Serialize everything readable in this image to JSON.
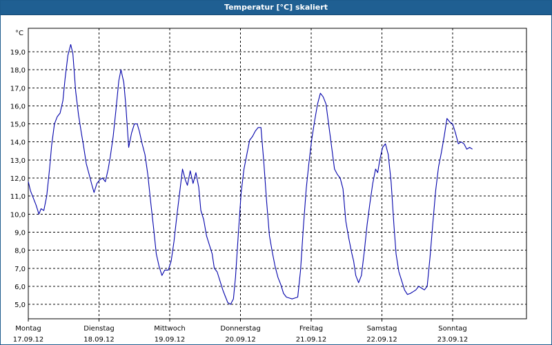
{
  "window": {
    "title": "Temperatur [°C] skaliert"
  },
  "chart_data": {
    "type": "line",
    "unit_label": "°C",
    "ylim": [
      4.2,
      20.3
    ],
    "yticks": [
      "5,0",
      "6,0",
      "7,0",
      "8,0",
      "9,0",
      "10,0",
      "11,0",
      "12,0",
      "13,0",
      "14,0",
      "15,0",
      "16,0",
      "17,0",
      "18,0",
      "19,0"
    ],
    "grid": true,
    "x_days": [
      {
        "weekday": "Montag",
        "date": "17.09.12"
      },
      {
        "weekday": "Dienstag",
        "date": "18.09.12"
      },
      {
        "weekday": "Mittwoch",
        "date": "19.09.12"
      },
      {
        "weekday": "Donnerstag",
        "date": "20.09.12"
      },
      {
        "weekday": "Freitag",
        "date": "21.09.12"
      },
      {
        "weekday": "Samstag",
        "date": "22.09.12"
      },
      {
        "weekday": "Sonntag",
        "date": "23.09.12"
      }
    ],
    "series": [
      {
        "color": "#0000aa",
        "points": [
          [
            0.0,
            11.8
          ],
          [
            0.03,
            11.3
          ],
          [
            0.07,
            10.9
          ],
          [
            0.11,
            10.5
          ],
          [
            0.15,
            10.0
          ],
          [
            0.18,
            10.3
          ],
          [
            0.22,
            10.2
          ],
          [
            0.26,
            11.0
          ],
          [
            0.3,
            12.5
          ],
          [
            0.33,
            13.8
          ],
          [
            0.37,
            15.0
          ],
          [
            0.41,
            15.4
          ],
          [
            0.45,
            15.6
          ],
          [
            0.49,
            16.3
          ],
          [
            0.52,
            17.5
          ],
          [
            0.56,
            18.8
          ],
          [
            0.6,
            19.4
          ],
          [
            0.63,
            18.9
          ],
          [
            0.67,
            16.8
          ],
          [
            0.71,
            15.5
          ],
          [
            0.75,
            14.5
          ],
          [
            0.78,
            13.8
          ],
          [
            0.82,
            12.8
          ],
          [
            0.86,
            12.2
          ],
          [
            0.9,
            11.6
          ],
          [
            0.93,
            11.2
          ],
          [
            0.97,
            11.7
          ],
          [
            1.01,
            11.9
          ],
          [
            1.05,
            12.0
          ],
          [
            1.09,
            11.8
          ],
          [
            1.13,
            12.5
          ],
          [
            1.16,
            13.2
          ],
          [
            1.2,
            14.3
          ],
          [
            1.24,
            15.8
          ],
          [
            1.28,
            17.4
          ],
          [
            1.31,
            18.0
          ],
          [
            1.35,
            17.3
          ],
          [
            1.38,
            16.0
          ],
          [
            1.42,
            13.7
          ],
          [
            1.46,
            14.5
          ],
          [
            1.5,
            15.0
          ],
          [
            1.54,
            15.0
          ],
          [
            1.57,
            14.6
          ],
          [
            1.61,
            13.9
          ],
          [
            1.65,
            13.3
          ],
          [
            1.69,
            12.2
          ],
          [
            1.73,
            10.7
          ],
          [
            1.77,
            9.3
          ],
          [
            1.81,
            7.8
          ],
          [
            1.85,
            7.1
          ],
          [
            1.89,
            6.6
          ],
          [
            1.93,
            6.9
          ],
          [
            1.98,
            6.9
          ],
          [
            2.02,
            7.4
          ],
          [
            2.06,
            8.5
          ],
          [
            2.1,
            9.9
          ],
          [
            2.14,
            11.2
          ],
          [
            2.18,
            12.5
          ],
          [
            2.22,
            11.9
          ],
          [
            2.25,
            11.6
          ],
          [
            2.29,
            12.4
          ],
          [
            2.33,
            11.7
          ],
          [
            2.37,
            12.3
          ],
          [
            2.41,
            11.5
          ],
          [
            2.44,
            10.2
          ],
          [
            2.48,
            9.7
          ],
          [
            2.52,
            8.8
          ],
          [
            2.56,
            8.3
          ],
          [
            2.6,
            7.8
          ],
          [
            2.63,
            7.0
          ],
          [
            2.67,
            6.8
          ],
          [
            2.71,
            6.3
          ],
          [
            2.75,
            5.8
          ],
          [
            2.78,
            5.5
          ],
          [
            2.82,
            5.1
          ],
          [
            2.86,
            5.0
          ],
          [
            2.9,
            5.3
          ],
          [
            2.93,
            6.5
          ],
          [
            2.97,
            8.9
          ],
          [
            3.01,
            11.2
          ],
          [
            3.05,
            12.5
          ],
          [
            3.09,
            13.3
          ],
          [
            3.13,
            14.1
          ],
          [
            3.17,
            14.3
          ],
          [
            3.21,
            14.6
          ],
          [
            3.25,
            14.8
          ],
          [
            3.29,
            14.8
          ],
          [
            3.33,
            12.9
          ],
          [
            3.37,
            10.7
          ],
          [
            3.41,
            8.8
          ],
          [
            3.45,
            7.9
          ],
          [
            3.49,
            7.1
          ],
          [
            3.53,
            6.5
          ],
          [
            3.57,
            6.1
          ],
          [
            3.61,
            5.6
          ],
          [
            3.65,
            5.4
          ],
          [
            3.69,
            5.35
          ],
          [
            3.73,
            5.3
          ],
          [
            3.77,
            5.35
          ],
          [
            3.81,
            5.4
          ],
          [
            3.85,
            6.9
          ],
          [
            3.89,
            9.3
          ],
          [
            3.93,
            11.4
          ],
          [
            3.97,
            12.9
          ],
          [
            4.01,
            14.2
          ],
          [
            4.05,
            15.2
          ],
          [
            4.09,
            16.1
          ],
          [
            4.13,
            16.7
          ],
          [
            4.17,
            16.5
          ],
          [
            4.21,
            16.1
          ],
          [
            4.25,
            14.9
          ],
          [
            4.29,
            13.7
          ],
          [
            4.33,
            12.5
          ],
          [
            4.37,
            12.2
          ],
          [
            4.41,
            12.0
          ],
          [
            4.45,
            11.4
          ],
          [
            4.49,
            9.6
          ],
          [
            4.53,
            8.7
          ],
          [
            4.57,
            7.9
          ],
          [
            4.6,
            7.4
          ],
          [
            4.63,
            6.6
          ],
          [
            4.67,
            6.2
          ],
          [
            4.71,
            6.6
          ],
          [
            4.75,
            7.9
          ],
          [
            4.79,
            9.4
          ],
          [
            4.83,
            10.6
          ],
          [
            4.87,
            11.7
          ],
          [
            4.91,
            12.5
          ],
          [
            4.94,
            12.3
          ],
          [
            4.97,
            13.0
          ],
          [
            5.01,
            13.7
          ],
          [
            5.05,
            13.9
          ],
          [
            5.09,
            13.3
          ],
          [
            5.13,
            11.8
          ],
          [
            5.17,
            9.4
          ],
          [
            5.2,
            7.8
          ],
          [
            5.24,
            6.8
          ],
          [
            5.28,
            6.3
          ],
          [
            5.32,
            5.8
          ],
          [
            5.36,
            5.55
          ],
          [
            5.4,
            5.6
          ],
          [
            5.44,
            5.7
          ],
          [
            5.48,
            5.8
          ],
          [
            5.52,
            6.0
          ],
          [
            5.56,
            5.9
          ],
          [
            5.6,
            5.8
          ],
          [
            5.64,
            6.0
          ],
          [
            5.68,
            7.6
          ],
          [
            5.72,
            9.5
          ],
          [
            5.76,
            11.3
          ],
          [
            5.8,
            12.6
          ],
          [
            5.84,
            13.4
          ],
          [
            5.88,
            14.3
          ],
          [
            5.92,
            15.3
          ],
          [
            5.96,
            15.1
          ],
          [
            6.0,
            15.0
          ],
          [
            6.04,
            14.5
          ],
          [
            6.08,
            13.9
          ],
          [
            6.12,
            14.0
          ],
          [
            6.16,
            13.9
          ],
          [
            6.2,
            13.6
          ],
          [
            6.24,
            13.7
          ],
          [
            6.28,
            13.6
          ]
        ]
      }
    ]
  }
}
